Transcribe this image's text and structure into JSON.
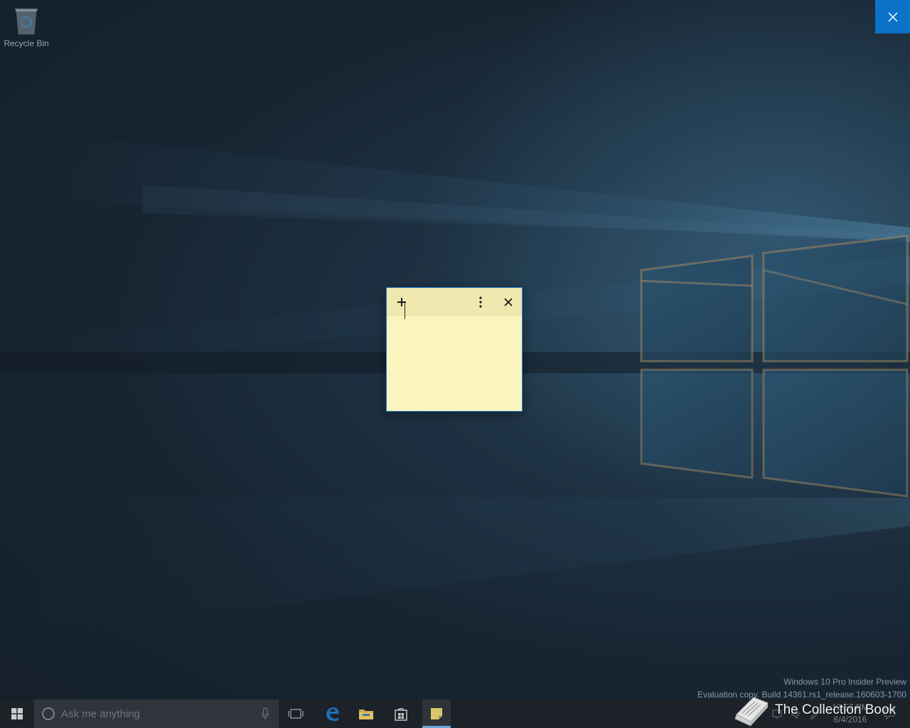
{
  "desktop": {
    "icons": [
      {
        "label": "Recycle Bin",
        "icon": "recycle-bin-icon"
      }
    ]
  },
  "overlay": {
    "close_icon": "close-icon",
    "accent": "#0b72c8"
  },
  "sticky_note": {
    "new_note_icon": "plus-icon",
    "menu_icon": "more-vertical-icon",
    "close_icon": "close-icon",
    "content": "",
    "background": "#faf5bf",
    "header_background": "#f0e8ae"
  },
  "watermark": {
    "line1": "Windows 10 Pro Insider Preview",
    "line2": "Evaluation copy. Build 14361.rs1_release.160603-1700"
  },
  "taskbar": {
    "start_icon": "windows-logo-icon",
    "search": {
      "placeholder": "Ask me anything",
      "cortana_icon": "cortana-circle-icon",
      "mic_icon": "microphone-icon"
    },
    "pinned": [
      {
        "name": "Task View",
        "icon": "task-view-icon"
      },
      {
        "name": "Microsoft Edge",
        "icon": "edge-icon"
      },
      {
        "name": "File Explorer",
        "icon": "folder-icon"
      },
      {
        "name": "Store",
        "icon": "store-icon"
      },
      {
        "name": "Sticky Notes",
        "icon": "sticky-notes-icon",
        "active": true
      }
    ],
    "tray": {
      "time": "12:57 PM",
      "date": "6/4/2016"
    }
  },
  "brand": {
    "text": "The Collection Book",
    "icon": "book-icon"
  }
}
